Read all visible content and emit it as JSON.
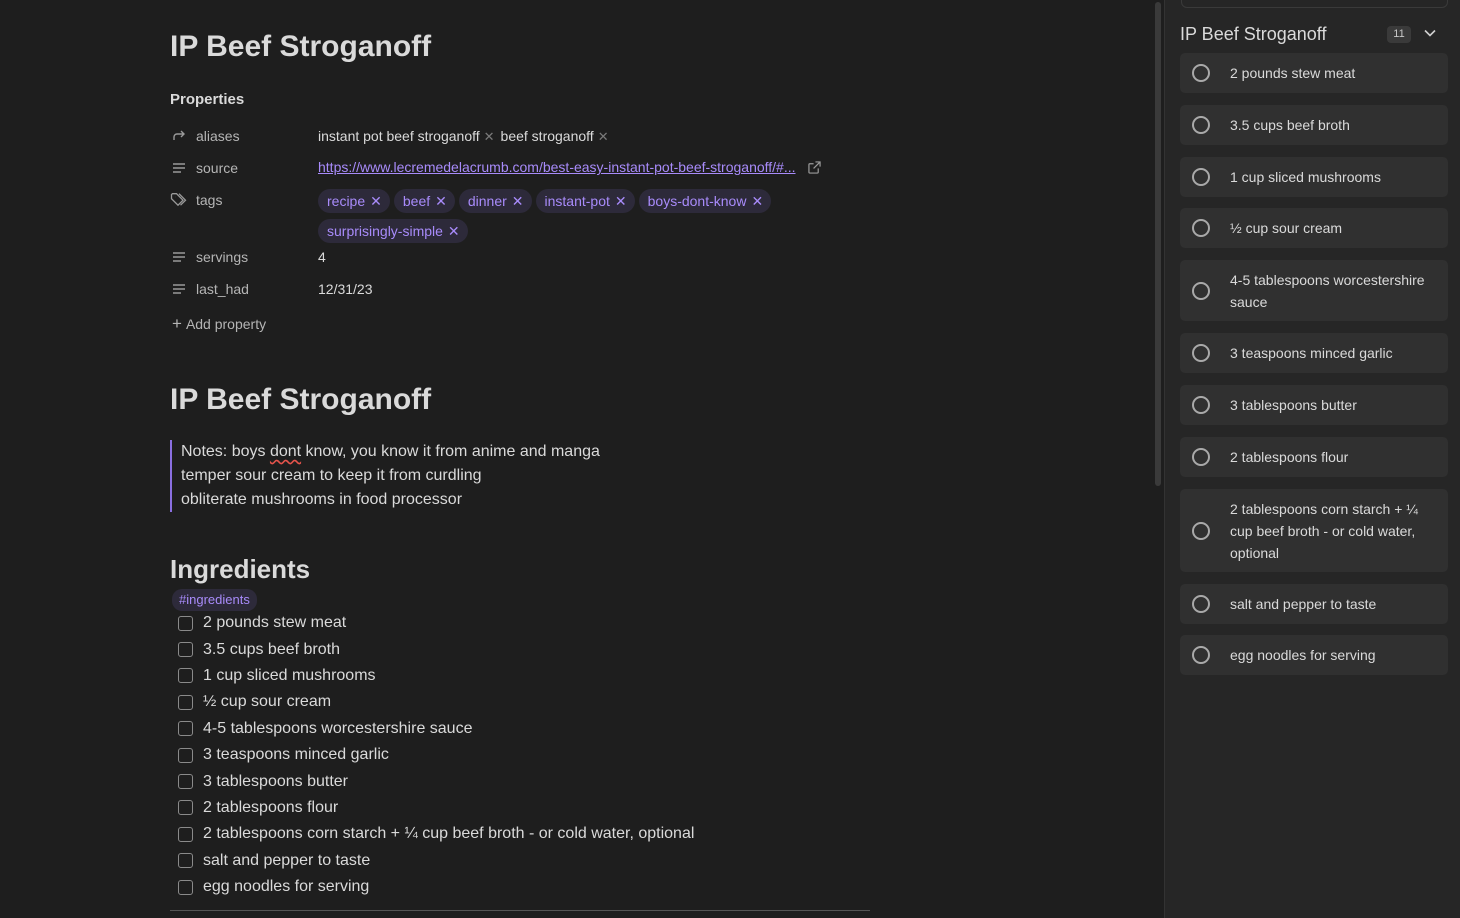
{
  "note": {
    "title": "IP Beef Stroganoff",
    "properties_heading": "Properties",
    "properties": {
      "aliases": {
        "key": "aliases",
        "values": [
          "instant pot beef stroganoff",
          "beef stroganoff"
        ]
      },
      "source": {
        "key": "source",
        "value": "https://www.lecremedelacrumb.com/best-easy-instant-pot-beef-stroganoff/#..."
      },
      "tags": {
        "key": "tags",
        "values": [
          "recipe",
          "beef",
          "dinner",
          "instant-pot",
          "boys-dont-know",
          "surprisingly-simple"
        ]
      },
      "servings": {
        "key": "servings",
        "value": "4"
      },
      "last_had": {
        "key": "last_had",
        "value": "12/31/23"
      }
    },
    "add_property": "Add property",
    "heading": "IP Beef Stroganoff",
    "notes": {
      "line1_prefix": "Notes: boys ",
      "line1_misspelled": "dont",
      "line1_suffix": " know, you know it from anime and manga",
      "line2": "temper sour cream to keep it from curdling",
      "line3": "obliterate mushrooms in food processor"
    },
    "ingredients_heading": "Ingredients",
    "ingredients_tag": "#ingredients",
    "ingredients": [
      "2 pounds stew meat",
      "3.5 cups beef broth",
      "1 cup sliced mushrooms",
      "½ cup sour cream",
      "4-5 tablespoons worcestershire sauce",
      "3 teaspoons minced garlic",
      "3 tablespoons butter",
      "2 tablespoons flour",
      "2 tablespoons corn starch + ¼ cup beef broth - or cold water, optional",
      "salt and pepper to taste",
      "egg noodles for serving"
    ]
  },
  "sidebar": {
    "title": "IP Beef Stroganoff",
    "count": "11",
    "tasks": [
      "2 pounds stew meat",
      "3.5 cups beef broth",
      "1 cup sliced mushrooms",
      "½ cup sour cream",
      "4-5 tablespoons worcestershire sauce",
      "3 teaspoons minced garlic",
      "3 tablespoons butter",
      "2 tablespoons flour",
      "2 tablespoons corn starch + ¼ cup beef broth - or cold water, optional",
      "salt and pepper to taste",
      "egg noodles for serving"
    ]
  },
  "colors": {
    "accent": "#a88bfa",
    "background": "#1e1e1e",
    "sidebar_bg": "#262626",
    "card_bg": "#303030"
  }
}
